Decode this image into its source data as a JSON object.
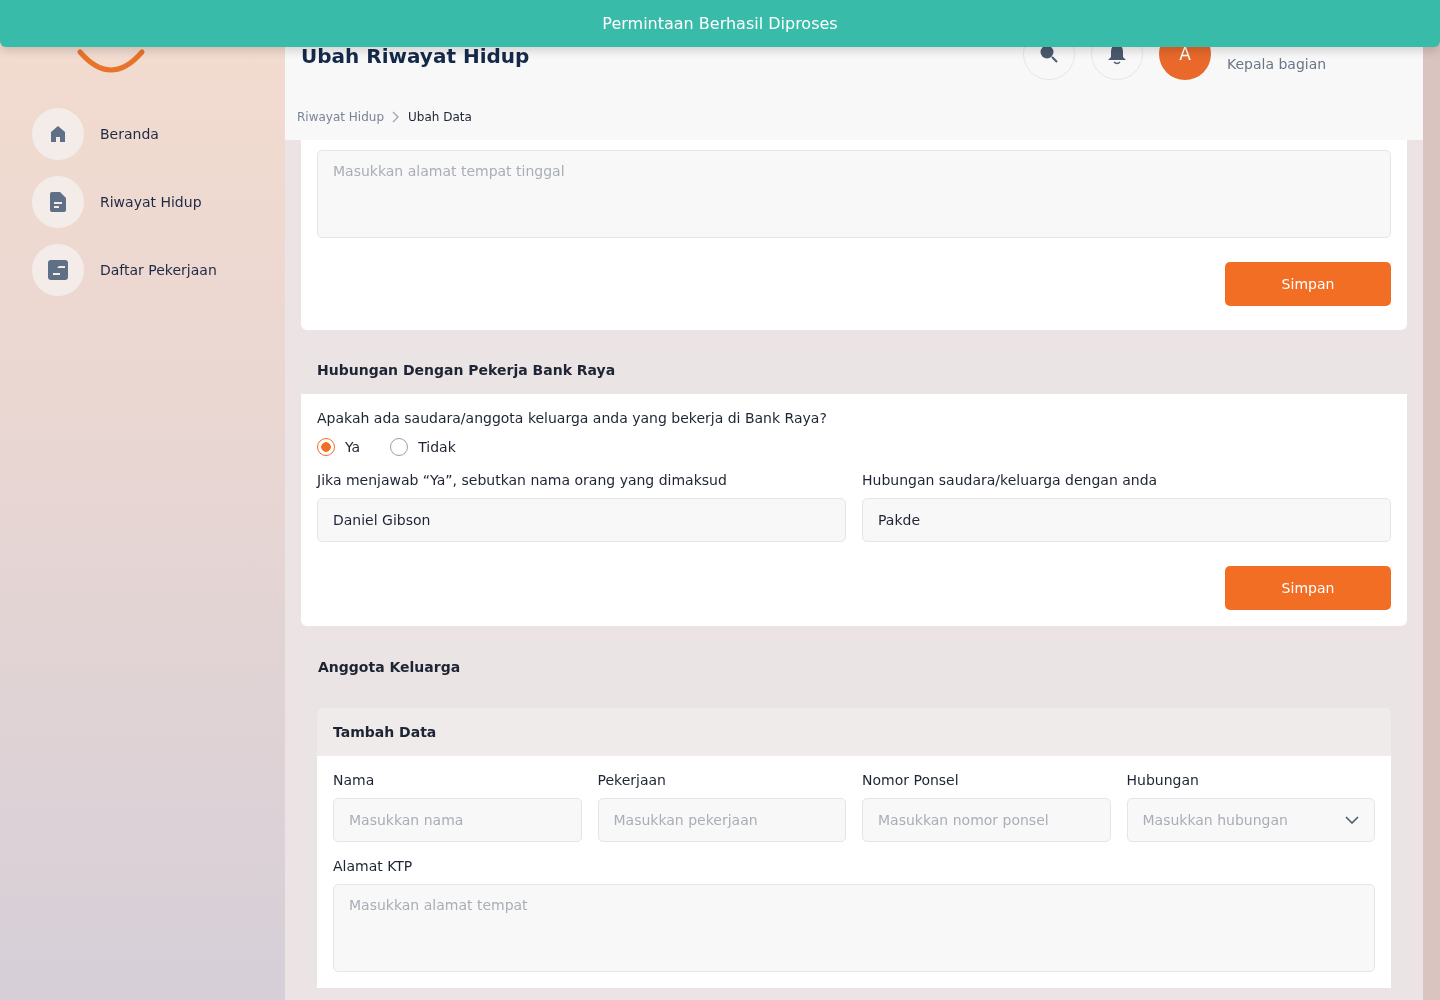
{
  "toast": {
    "message": "Permintaan Berhasil Diproses"
  },
  "sidebar": {
    "items": [
      {
        "label": "Beranda",
        "selected": false
      },
      {
        "label": "Riwayat Hidup",
        "selected": false
      },
      {
        "label": "Daftar Pekerjaan",
        "selected": false
      }
    ]
  },
  "header": {
    "title": "Ubah Riwayat Hidup",
    "user": {
      "avatar_initial": "A",
      "role": "Kepala bagian"
    }
  },
  "breadcrumb": [
    "Riwayat Hidup",
    "Ubah Data"
  ],
  "address_section": {
    "placeholder": "Masukkan alamat tempat tinggal",
    "button": "Simpan"
  },
  "relation_section": {
    "title": "Hubungan Dengan Pekerja Bank Raya",
    "question": "Apakah ada saudara/anggota keluarga anda yang bekerja di Bank Raya?",
    "options": [
      {
        "label": "Ya",
        "selected": true
      },
      {
        "label": "Tidak",
        "selected": false
      }
    ],
    "fields": [
      {
        "label": "Jika menjawab “Ya”, sebutkan nama orang yang dimaksud",
        "value": "Daniel Gibson"
      },
      {
        "label": "Hubungan saudara/keluarga dengan anda",
        "value": "Pakde"
      }
    ],
    "button": "Simpan"
  },
  "family_section": {
    "title": "Anggota Keluarga",
    "subtitle": "Tambah Data",
    "fields": [
      {
        "label": "Nama",
        "placeholder": "Masukkan nama",
        "kind": "text"
      },
      {
        "label": "Pekerjaan",
        "placeholder": "Masukkan pekerjaan",
        "kind": "text"
      },
      {
        "label": "Nomor Ponsel",
        "placeholder": "Masukkan nomor ponsel",
        "kind": "text"
      },
      {
        "label": "Hubungan",
        "placeholder": "Masukkan hubungan",
        "kind": "select"
      }
    ],
    "address": {
      "label": "Alamat KTP",
      "placeholder": "Masukkan alamat tempat"
    }
  }
}
